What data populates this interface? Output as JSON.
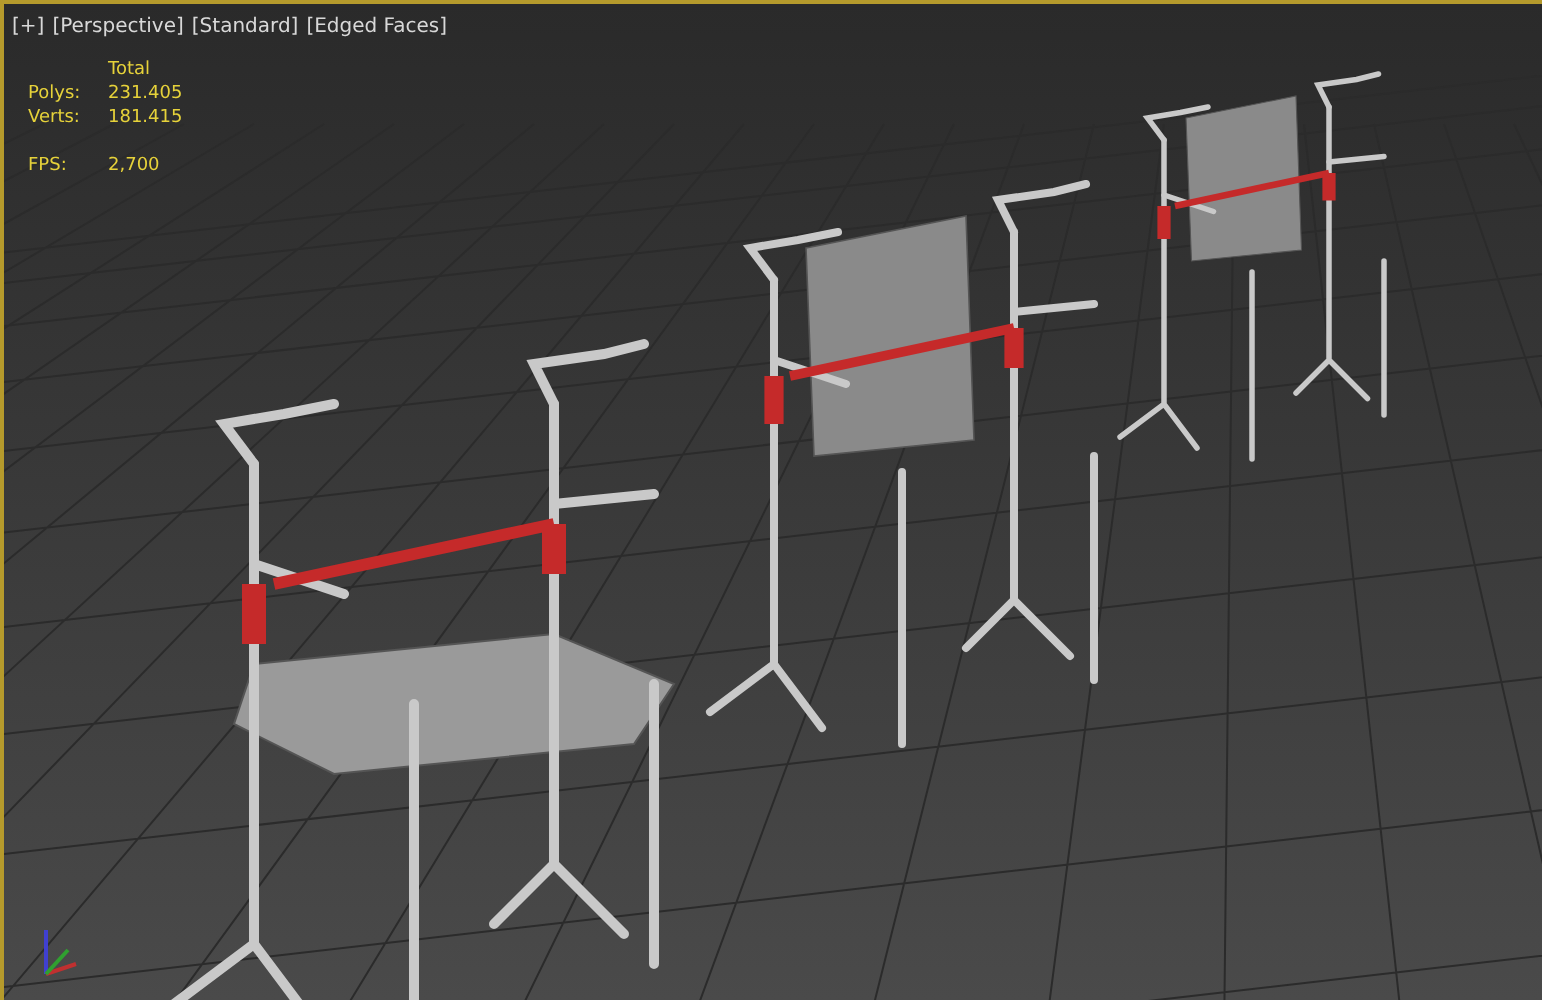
{
  "viewport": {
    "labels": [
      {
        "text": "[+]"
      },
      {
        "text": "[Perspective]"
      },
      {
        "text": "[Standard]"
      },
      {
        "text": "[Edged Faces]"
      }
    ],
    "active": true,
    "stats": {
      "header": "Total",
      "rows": [
        {
          "label": "Polys:",
          "value": "231.405"
        },
        {
          "label": "Verts:",
          "value": "181.415"
        }
      ],
      "fps": {
        "label": "FPS:",
        "value": "2,700"
      }
    }
  }
}
